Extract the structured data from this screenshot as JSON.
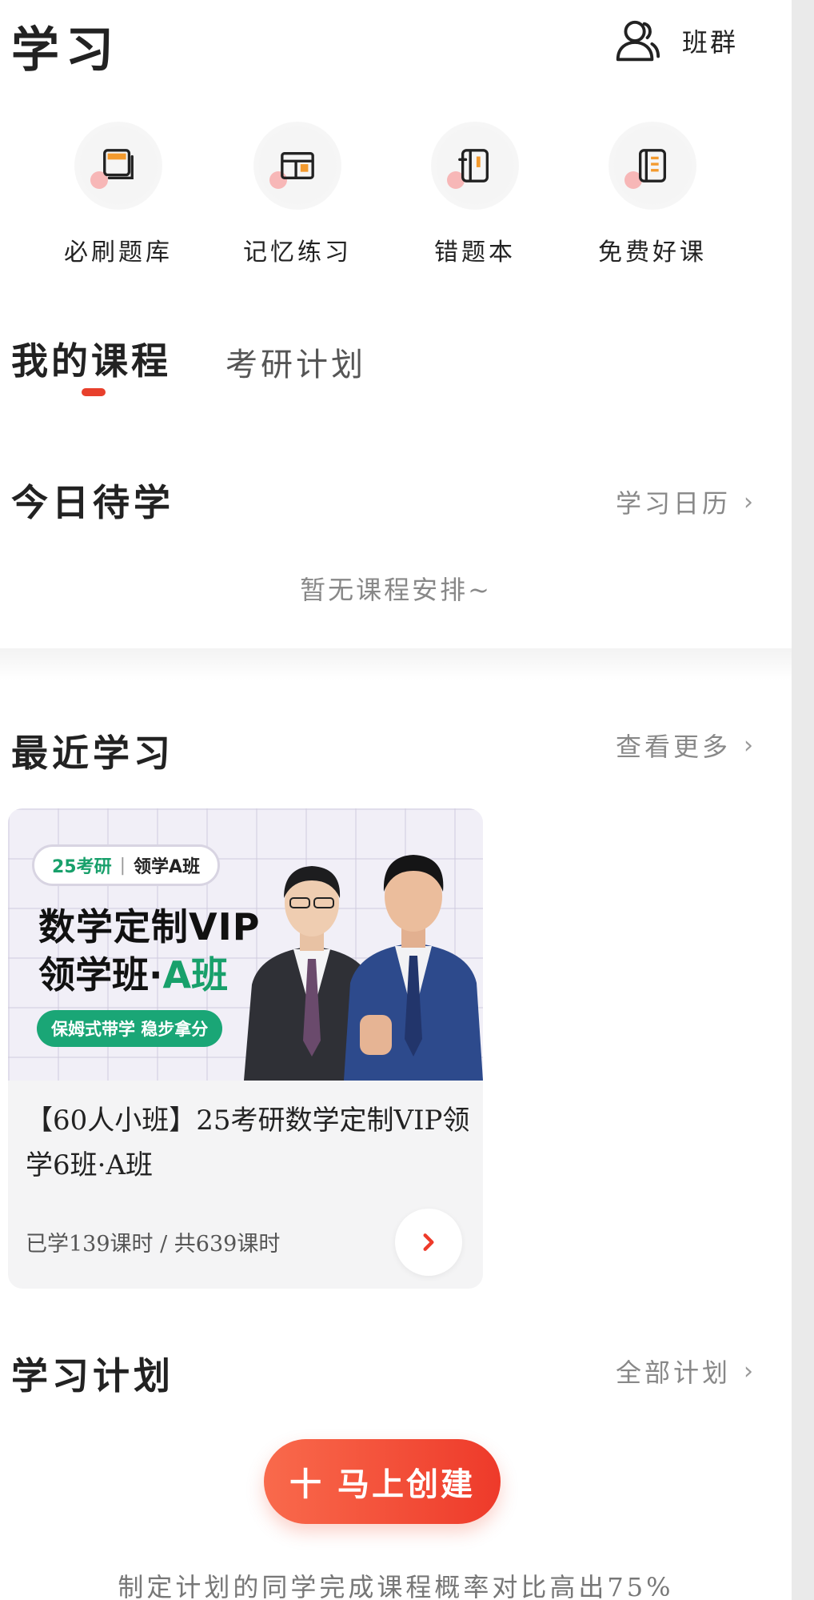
{
  "header": {
    "title": "学习",
    "group_label": "班群"
  },
  "quick_actions": [
    {
      "label": "必刷题库",
      "icon": "question-bank-icon"
    },
    {
      "label": "记忆练习",
      "icon": "memory-practice-icon"
    },
    {
      "label": "错题本",
      "icon": "mistake-book-icon"
    },
    {
      "label": "免费好课",
      "icon": "free-course-icon"
    }
  ],
  "tabs": {
    "active": "我的课程",
    "other": "考研计划"
  },
  "today": {
    "title": "今日待学",
    "link": "学习日历",
    "empty_text": "暂无课程安排~"
  },
  "recent": {
    "title": "最近学习",
    "link": "查看更多",
    "course": {
      "banner_tag_left": "25考研",
      "banner_tag_right": "领学A班",
      "banner_line1": "数学定制VIP",
      "banner_line2_a": "领学班·",
      "banner_line2_b": "A班",
      "banner_pill": "保姆式带学  稳步拿分",
      "title": "【60人小班】25考研数学定制VIP领学6班·A班",
      "progress": "已学139课时 / 共639课时"
    }
  },
  "plan": {
    "title": "学习计划",
    "link": "全部计划",
    "create_label": "十 马上创建",
    "footnote": "制定计划的同学完成课程概率对比高出75%"
  },
  "colors": {
    "accent": "#ee3a2a",
    "brand_green": "#18a06b"
  }
}
